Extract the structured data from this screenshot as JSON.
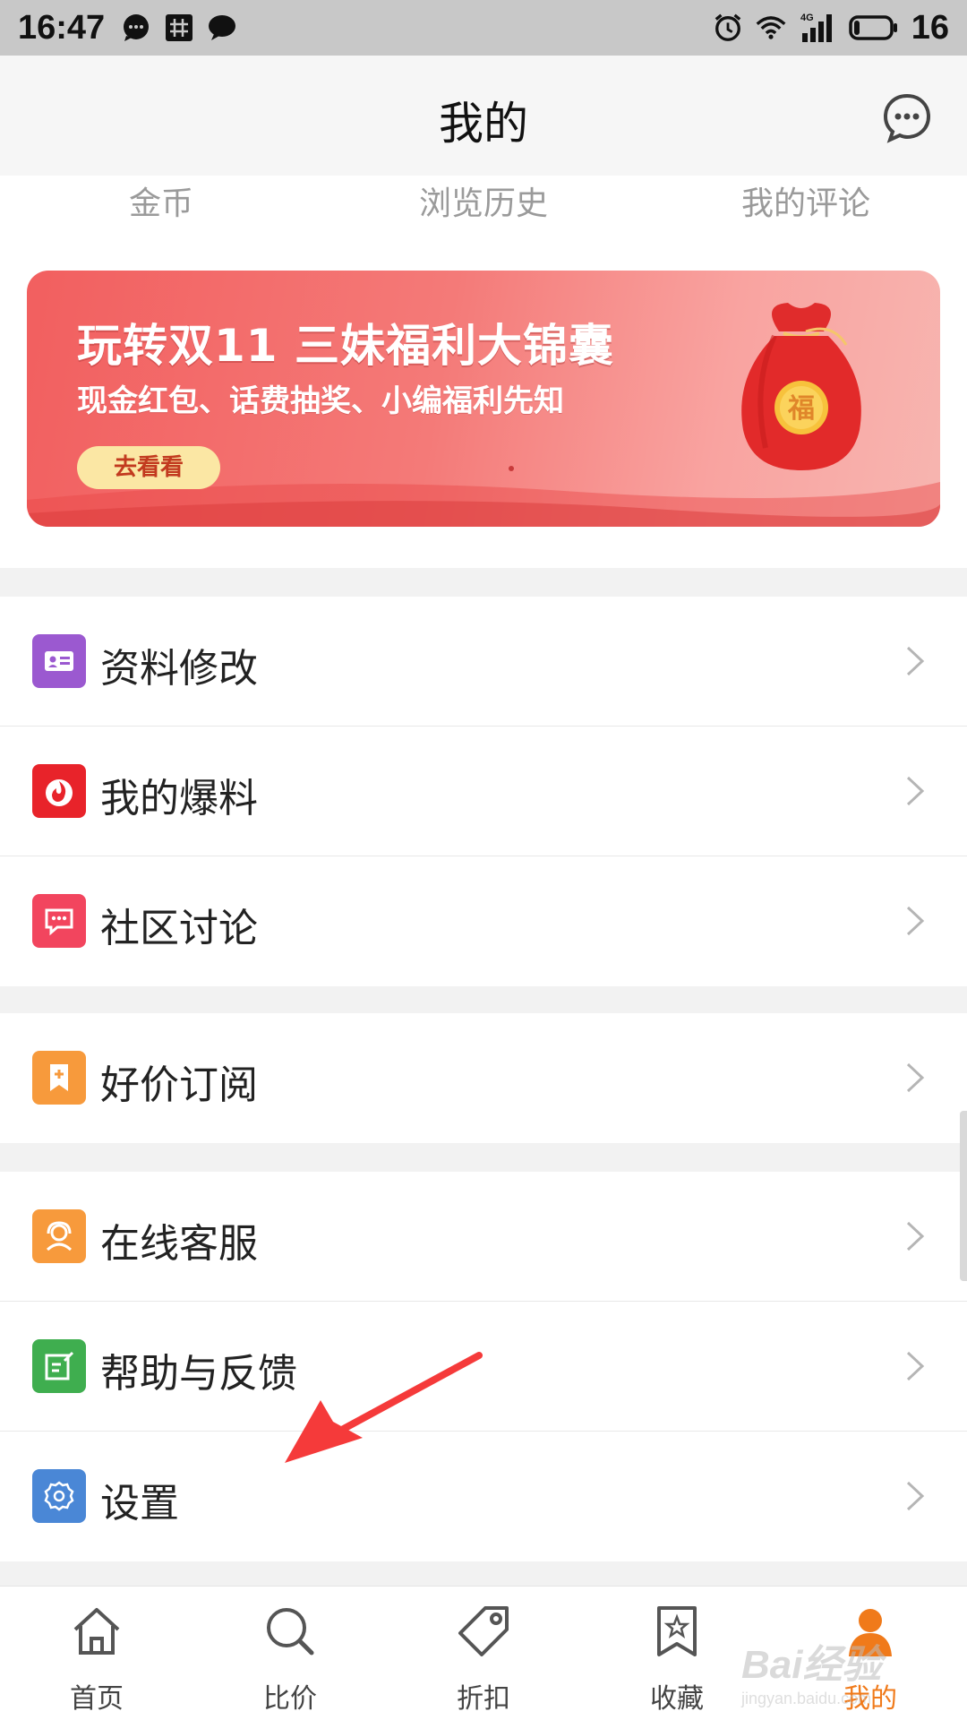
{
  "status_bar": {
    "time": "16:47",
    "battery_level": "16",
    "network": "4G",
    "left_icons": [
      "chat-bubble-icon",
      "hash-grid-icon",
      "message-icon"
    ],
    "right_icons": [
      "alarm-icon",
      "wifi-icon",
      "signal-icon",
      "battery-icon"
    ]
  },
  "header": {
    "title": "我的",
    "right_icon": "message-dots-icon"
  },
  "quick_row": {
    "items": [
      "金币",
      "浏览历史",
      "我的评论"
    ]
  },
  "banner": {
    "title": "玩转双11 三妹福利大锦囊",
    "subtitle": "现金红包、话费抽奖、小编福利先知",
    "button": "去看看",
    "bag_char": "福"
  },
  "menu": {
    "group1": [
      {
        "label": "资料修改",
        "icon": "profile-card-icon",
        "color": "#9b59d0"
      },
      {
        "label": "我的爆料",
        "icon": "fire-icon",
        "color": "#e8232a"
      },
      {
        "label": "社区讨论",
        "icon": "chat-dots-icon",
        "color": "#f2455e"
      }
    ],
    "group2": [
      {
        "label": "好价订阅",
        "icon": "bookmark-plus-icon",
        "color": "#f79a3c"
      }
    ],
    "group3": [
      {
        "label": "在线客服",
        "icon": "customer-service-icon",
        "color": "#f79a3c"
      },
      {
        "label": "帮助与反馈",
        "icon": "edit-note-icon",
        "color": "#3fae4f"
      },
      {
        "label": "设置",
        "icon": "gear-icon",
        "color": "#4a87d6"
      }
    ]
  },
  "bottom_nav": {
    "items": [
      {
        "label": "首页",
        "icon": "home-icon"
      },
      {
        "label": "比价",
        "icon": "search-icon"
      },
      {
        "label": "折扣",
        "icon": "tag-icon"
      },
      {
        "label": "收藏",
        "icon": "star-bookmark-icon"
      },
      {
        "label": "我的",
        "icon": "person-icon",
        "active": true
      }
    ]
  },
  "watermark": {
    "line1": "Bai经验",
    "line2": "jingyan.baidu.com"
  },
  "colors": {
    "accent": "#f07a1a",
    "banner_red": "#f25f5f",
    "annotation_arrow": "#f53a3a"
  }
}
